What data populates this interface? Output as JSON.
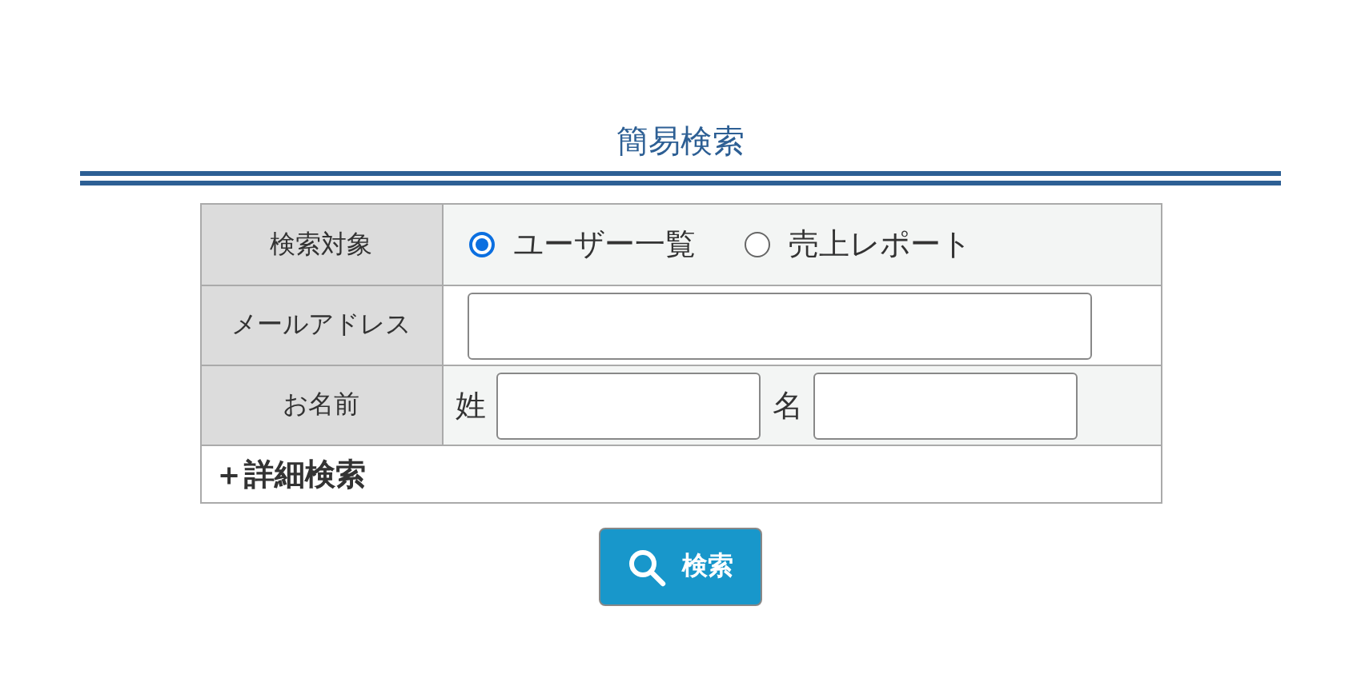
{
  "title": "簡易検索",
  "form": {
    "target": {
      "label": "検索対象",
      "options": [
        {
          "label": "ユーザー一覧",
          "selected": true
        },
        {
          "label": "売上レポート",
          "selected": false
        }
      ]
    },
    "email": {
      "label": "メールアドレス"
    },
    "name": {
      "label": "お名前",
      "last_label": "姓",
      "first_label": "名"
    },
    "advanced_toggle": "＋詳細検索"
  },
  "search_button": "検索"
}
